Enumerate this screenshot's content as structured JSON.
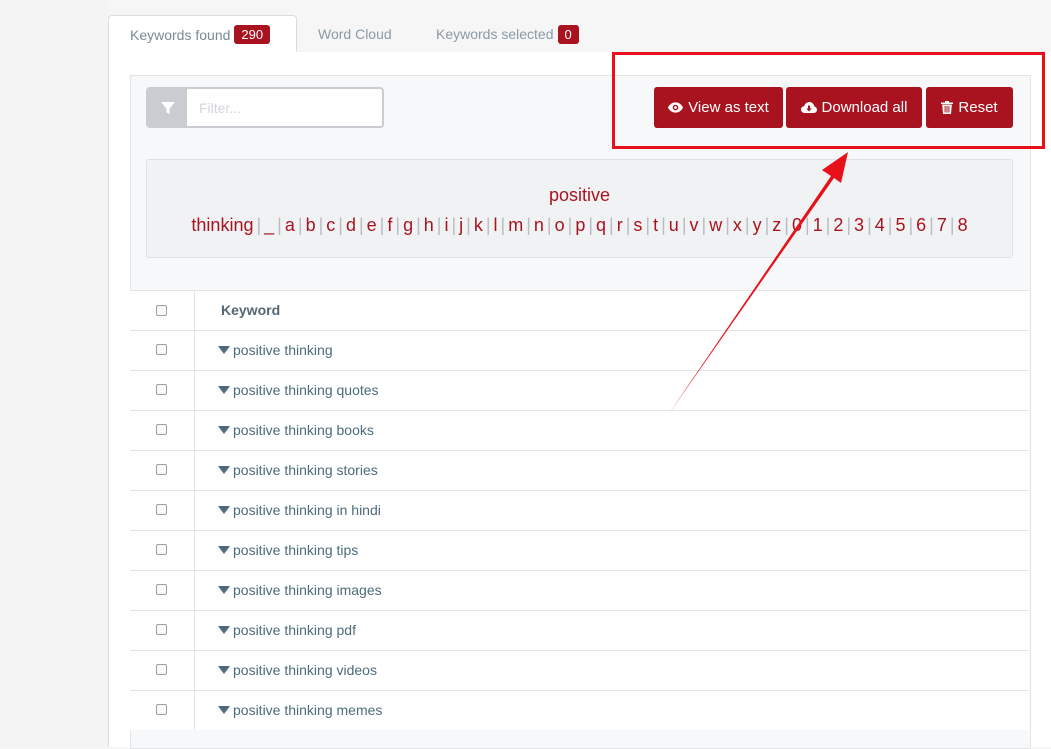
{
  "tabs": {
    "keywords_found": {
      "label": "Keywords found",
      "count": "290"
    },
    "word_cloud": {
      "label": "Word Cloud"
    },
    "keywords_selected": {
      "label": "Keywords selected",
      "count": "0"
    }
  },
  "filter": {
    "placeholder": "Filter..."
  },
  "buttons": {
    "view_as_text": "View as text",
    "download_all": "Download all",
    "reset": "Reset"
  },
  "alphabet": {
    "links": [
      "positive thinking",
      "_",
      "a",
      "b",
      "c",
      "d",
      "e",
      "f",
      "g",
      "h",
      "i",
      "j",
      "k",
      "l",
      "m",
      "n",
      "o",
      "p",
      "q",
      "r",
      "s",
      "t",
      "u",
      "v",
      "w",
      "x",
      "y",
      "z",
      "0",
      "1",
      "2",
      "3",
      "4",
      "5",
      "6",
      "7",
      "8"
    ]
  },
  "table": {
    "header": "Keyword",
    "rows": [
      "positive thinking",
      "positive thinking quotes",
      "positive thinking books",
      "positive thinking stories",
      "positive thinking in hindi",
      "positive thinking tips",
      "positive thinking images",
      "positive thinking pdf",
      "positive thinking videos",
      "positive thinking memes"
    ]
  },
  "colors": {
    "accent": "#a8131f",
    "annotation": "#e8101a",
    "keyword_text": "#4d6b7c"
  },
  "icons": {
    "filter": "funnel-icon",
    "view": "eye-icon",
    "download": "cloud-download-icon",
    "reset": "trash-icon",
    "expand": "caret-down-icon"
  }
}
